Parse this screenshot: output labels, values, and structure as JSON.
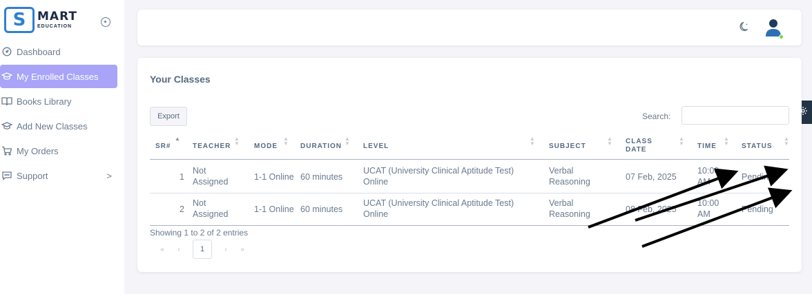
{
  "brand": {
    "logo_letter": "S",
    "name": "MART",
    "tagline": "EDUCATION"
  },
  "sidebar": {
    "items": [
      {
        "label": "Dashboard",
        "icon": "dashboard-icon"
      },
      {
        "label": "My Enrolled Classes",
        "icon": "graduation-cap-icon",
        "active": true
      },
      {
        "label": "Books Library",
        "icon": "book-icon"
      },
      {
        "label": "Add New Classes",
        "icon": "graduation-cap-icon"
      },
      {
        "label": "My Orders",
        "icon": "cart-icon"
      },
      {
        "label": "Support",
        "icon": "chat-icon",
        "chevron": ">"
      }
    ]
  },
  "topbar": {
    "theme_icon": "moon-icon",
    "avatar_icon": "user-avatar-icon"
  },
  "card": {
    "title": "Your Classes",
    "export_label": "Export",
    "search_label": "Search:",
    "search_value": ""
  },
  "table": {
    "headers": {
      "sr": "SR#",
      "teacher": "TEACHER",
      "mode": "MODE",
      "duration": "DURATION",
      "level": "LEVEL",
      "subject": "SUBJECT",
      "class_date_1": "CLASS",
      "class_date_2": "DATE",
      "time": "TIME",
      "status": "STATUS"
    },
    "rows": [
      {
        "sr": "1",
        "teacher_1": "Not",
        "teacher_2": "Assigned",
        "mode": "1-1 Online",
        "duration": "60 minutes",
        "level_1": "UCAT (University Clinical Aptitude Test)",
        "level_2": "Online",
        "subject_1": "Verbal",
        "subject_2": "Reasoning",
        "date": "07 Feb, 2025",
        "time_1": "10:00",
        "time_2": "AM",
        "status": "Pending"
      },
      {
        "sr": "2",
        "teacher_1": "Not",
        "teacher_2": "Assigned",
        "mode": "1-1 Online",
        "duration": "60 minutes",
        "level_1": "UCAT (University Clinical Aptitude Test)",
        "level_2": "Online",
        "subject_1": "Verbal",
        "subject_2": "Reasoning",
        "date": "08 Feb, 2025",
        "time_1": "10:00",
        "time_2": "AM",
        "status": "Pending"
      }
    ]
  },
  "footer": {
    "info": "Showing 1 to 2 of 2 entries",
    "pager": {
      "first": "«",
      "prev": "‹",
      "current": "1",
      "next": "›",
      "last": "»"
    }
  },
  "colors": {
    "accent": "#a9a4f7",
    "brand": "#2f7fd3",
    "fab": "#233446",
    "online": "#71dd37"
  }
}
